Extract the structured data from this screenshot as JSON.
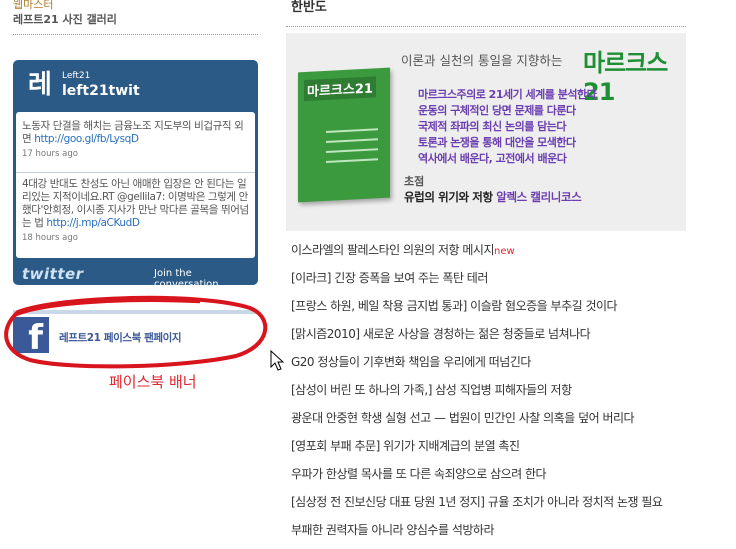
{
  "left": {
    "webmaster_label": "웹마스터",
    "gallery_link": "레프트21 사진 갤러리",
    "twitter_widget": {
      "avatar_letter": "레",
      "handle_small": "Left21",
      "handle": "left21twit",
      "tweets": [
        {
          "text": "노동자 단결을 해치는 금융노조 지도부의 비겁규직 외면",
          "link": "http://goo.gl/fb/LysqD",
          "time": "17 hours ago"
        },
        {
          "text": "4대강 반대도 찬성도 아닌 애매한 입장은 안 된다는 일리있는 지적이네요.RT @gellila7: 이명박은 그렇게 안했다'안희정, 이시종 지사가 만난 막다른 골목을 뛰어넘는 법",
          "link": "http://j.mp/aCKudD",
          "time": "18 hours ago"
        }
      ],
      "wordmark": "twitter",
      "join": "Join the conversation"
    },
    "facebook": {
      "icon_letter": "f",
      "label": "레프트21 페이스북 팬페이지"
    },
    "annotation": "페이스북 배너"
  },
  "right": {
    "section_title": "한반도",
    "banner": {
      "tagline": "이론과 실천의 통일을 지향하는",
      "logo": "마르크스21",
      "book_title": "마르크스21",
      "lines": [
        "마르크스주의로 21세기 세계를 분석한다",
        "운동의 구체적인 당면 문제를 다룬다",
        "국제적 좌파의 최신 논의를 담는다",
        "토론과 논쟁을 통해 대안을 모색한다",
        "역사에서 배운다, 고전에서 배운다"
      ],
      "feature_label": "초점",
      "feature_title": "유럽의 위기와 저항",
      "feature_author": "알렉스 캘리니코스"
    },
    "headlines": [
      {
        "text": "이스라엘의 팔레스타인 의원의 저항 메시지",
        "badge": "new"
      },
      {
        "text": "[이라크] 긴장 증폭을 보여 주는 폭탄 테러",
        "badge": ""
      },
      {
        "text": "[프랑스 하원, 베일 착용 금지법 통과] 이슬람 혐오증을 부추길 것이다",
        "badge": ""
      },
      {
        "text": "[맑시즘2010] 새로운 사상을 경청하는 젊은 청중들로 넘쳐나다",
        "badge": ""
      },
      {
        "text": "G20 정상들이 기후변화 책임을 우리에게 떠넘긴다",
        "badge": ""
      },
      {
        "text": "[삼성이 버린 또 하나의 가족,] 삼성 직업병 피해자들의 저항",
        "badge": ""
      },
      {
        "text": "광운대 안중현 학생 실형 선고 — 법원이 민간인 사찰 의혹을 덮어 버리다",
        "badge": ""
      },
      {
        "text": "[영포회 부패 추문] 위기가 지배계급의 분열 촉진",
        "badge": ""
      },
      {
        "text": "우파가 한상렬 목사를 또 다른 속죄양으로 삼으려 한다",
        "badge": ""
      },
      {
        "text": "[심상정 전 진보신당 대표 당원 1년 정지] 규율 조치가 아니라 정치적 논쟁 필요",
        "badge": ""
      },
      {
        "text": "부패한 권력자들 아니라 양심수를 석방하라",
        "badge": ""
      }
    ]
  },
  "colors": {
    "twitter_blue": "#2b5a86",
    "facebook_blue": "#3b5998",
    "annotation_red": "#e0262f",
    "banner_green": "#1f8f34"
  }
}
